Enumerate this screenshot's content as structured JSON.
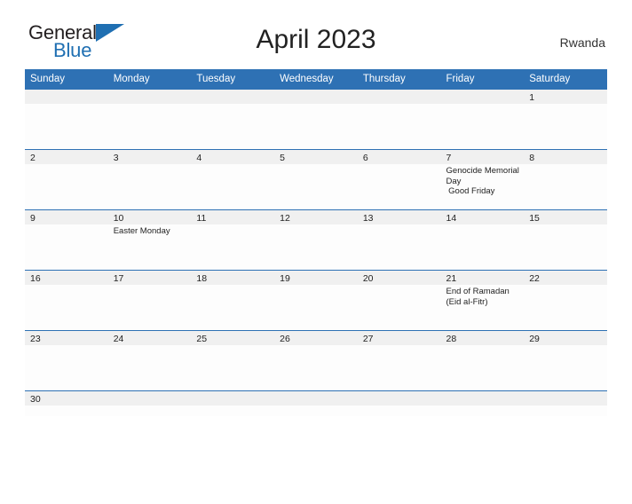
{
  "brand": {
    "word_one": "General",
    "word_two": "Blue",
    "flag_icon": "flag-triangle-icon",
    "color_primary": "#1f6fb2",
    "color_text": "#231f20"
  },
  "header": {
    "title": "April 2023",
    "country": "Rwanda",
    "header_bg": "#2e71b4",
    "date_band_bg": "#f0f0f0"
  },
  "weekday_headers": [
    "Sunday",
    "Monday",
    "Tuesday",
    "Wednesday",
    "Thursday",
    "Friday",
    "Saturday"
  ],
  "weeks": [
    {
      "days": [
        {
          "date": "",
          "events": []
        },
        {
          "date": "",
          "events": []
        },
        {
          "date": "",
          "events": []
        },
        {
          "date": "",
          "events": []
        },
        {
          "date": "",
          "events": []
        },
        {
          "date": "",
          "events": []
        },
        {
          "date": "1",
          "events": []
        }
      ]
    },
    {
      "days": [
        {
          "date": "2",
          "events": []
        },
        {
          "date": "3",
          "events": []
        },
        {
          "date": "4",
          "events": []
        },
        {
          "date": "5",
          "events": []
        },
        {
          "date": "6",
          "events": []
        },
        {
          "date": "7",
          "events": [
            "Genocide Memorial Day",
            " Good Friday"
          ]
        },
        {
          "date": "8",
          "events": []
        }
      ]
    },
    {
      "days": [
        {
          "date": "9",
          "events": []
        },
        {
          "date": "10",
          "events": [
            "Easter Monday"
          ]
        },
        {
          "date": "11",
          "events": []
        },
        {
          "date": "12",
          "events": []
        },
        {
          "date": "13",
          "events": []
        },
        {
          "date": "14",
          "events": []
        },
        {
          "date": "15",
          "events": []
        }
      ]
    },
    {
      "days": [
        {
          "date": "16",
          "events": []
        },
        {
          "date": "17",
          "events": []
        },
        {
          "date": "18",
          "events": []
        },
        {
          "date": "19",
          "events": []
        },
        {
          "date": "20",
          "events": []
        },
        {
          "date": "21",
          "events": [
            "End of Ramadan (Eid al-Fitr)"
          ]
        },
        {
          "date": "22",
          "events": []
        }
      ]
    },
    {
      "days": [
        {
          "date": "23",
          "events": []
        },
        {
          "date": "24",
          "events": []
        },
        {
          "date": "25",
          "events": []
        },
        {
          "date": "26",
          "events": []
        },
        {
          "date": "27",
          "events": []
        },
        {
          "date": "28",
          "events": []
        },
        {
          "date": "29",
          "events": []
        }
      ]
    },
    {
      "days": [
        {
          "date": "30",
          "events": []
        },
        {
          "date": "",
          "events": []
        },
        {
          "date": "",
          "events": []
        },
        {
          "date": "",
          "events": []
        },
        {
          "date": "",
          "events": []
        },
        {
          "date": "",
          "events": []
        },
        {
          "date": "",
          "events": []
        }
      ]
    }
  ]
}
